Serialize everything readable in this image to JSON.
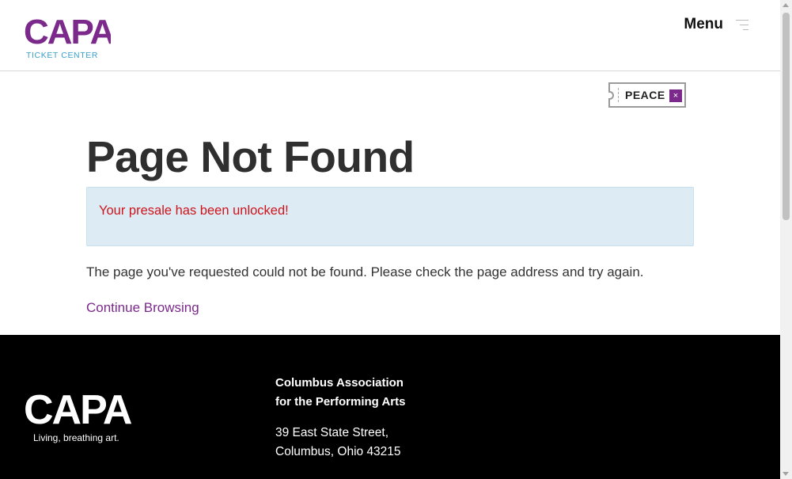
{
  "header": {
    "logo_text": "CAPA",
    "logo_subtitle": "TICKET CENTER",
    "menu_label": "Menu"
  },
  "promo": {
    "code": "PEACE",
    "remove_symbol": "×"
  },
  "main": {
    "title": "Page Not Found",
    "alert": "Your presale has been unlocked!",
    "message": "The page you've requested could not be found. Please check the page address and try again.",
    "continue_link": "Continue Browsing"
  },
  "footer": {
    "logo_text": "CAPA",
    "tagline": "Living, breathing art.",
    "org_line1": "Columbus Association",
    "org_line2": "for the Performing Arts",
    "address_line1": "39 East State Street,",
    "address_line2": "Columbus, Ohio 43215"
  },
  "colors": {
    "brand_purple": "#7b2a8b",
    "brand_blue": "#3aa0c8",
    "alert_bg": "#dcebf4",
    "alert_text": "#d0131b",
    "footer_bg": "#000000"
  },
  "icons": {
    "menu": "hamburger-icon",
    "remove": "close-icon"
  }
}
